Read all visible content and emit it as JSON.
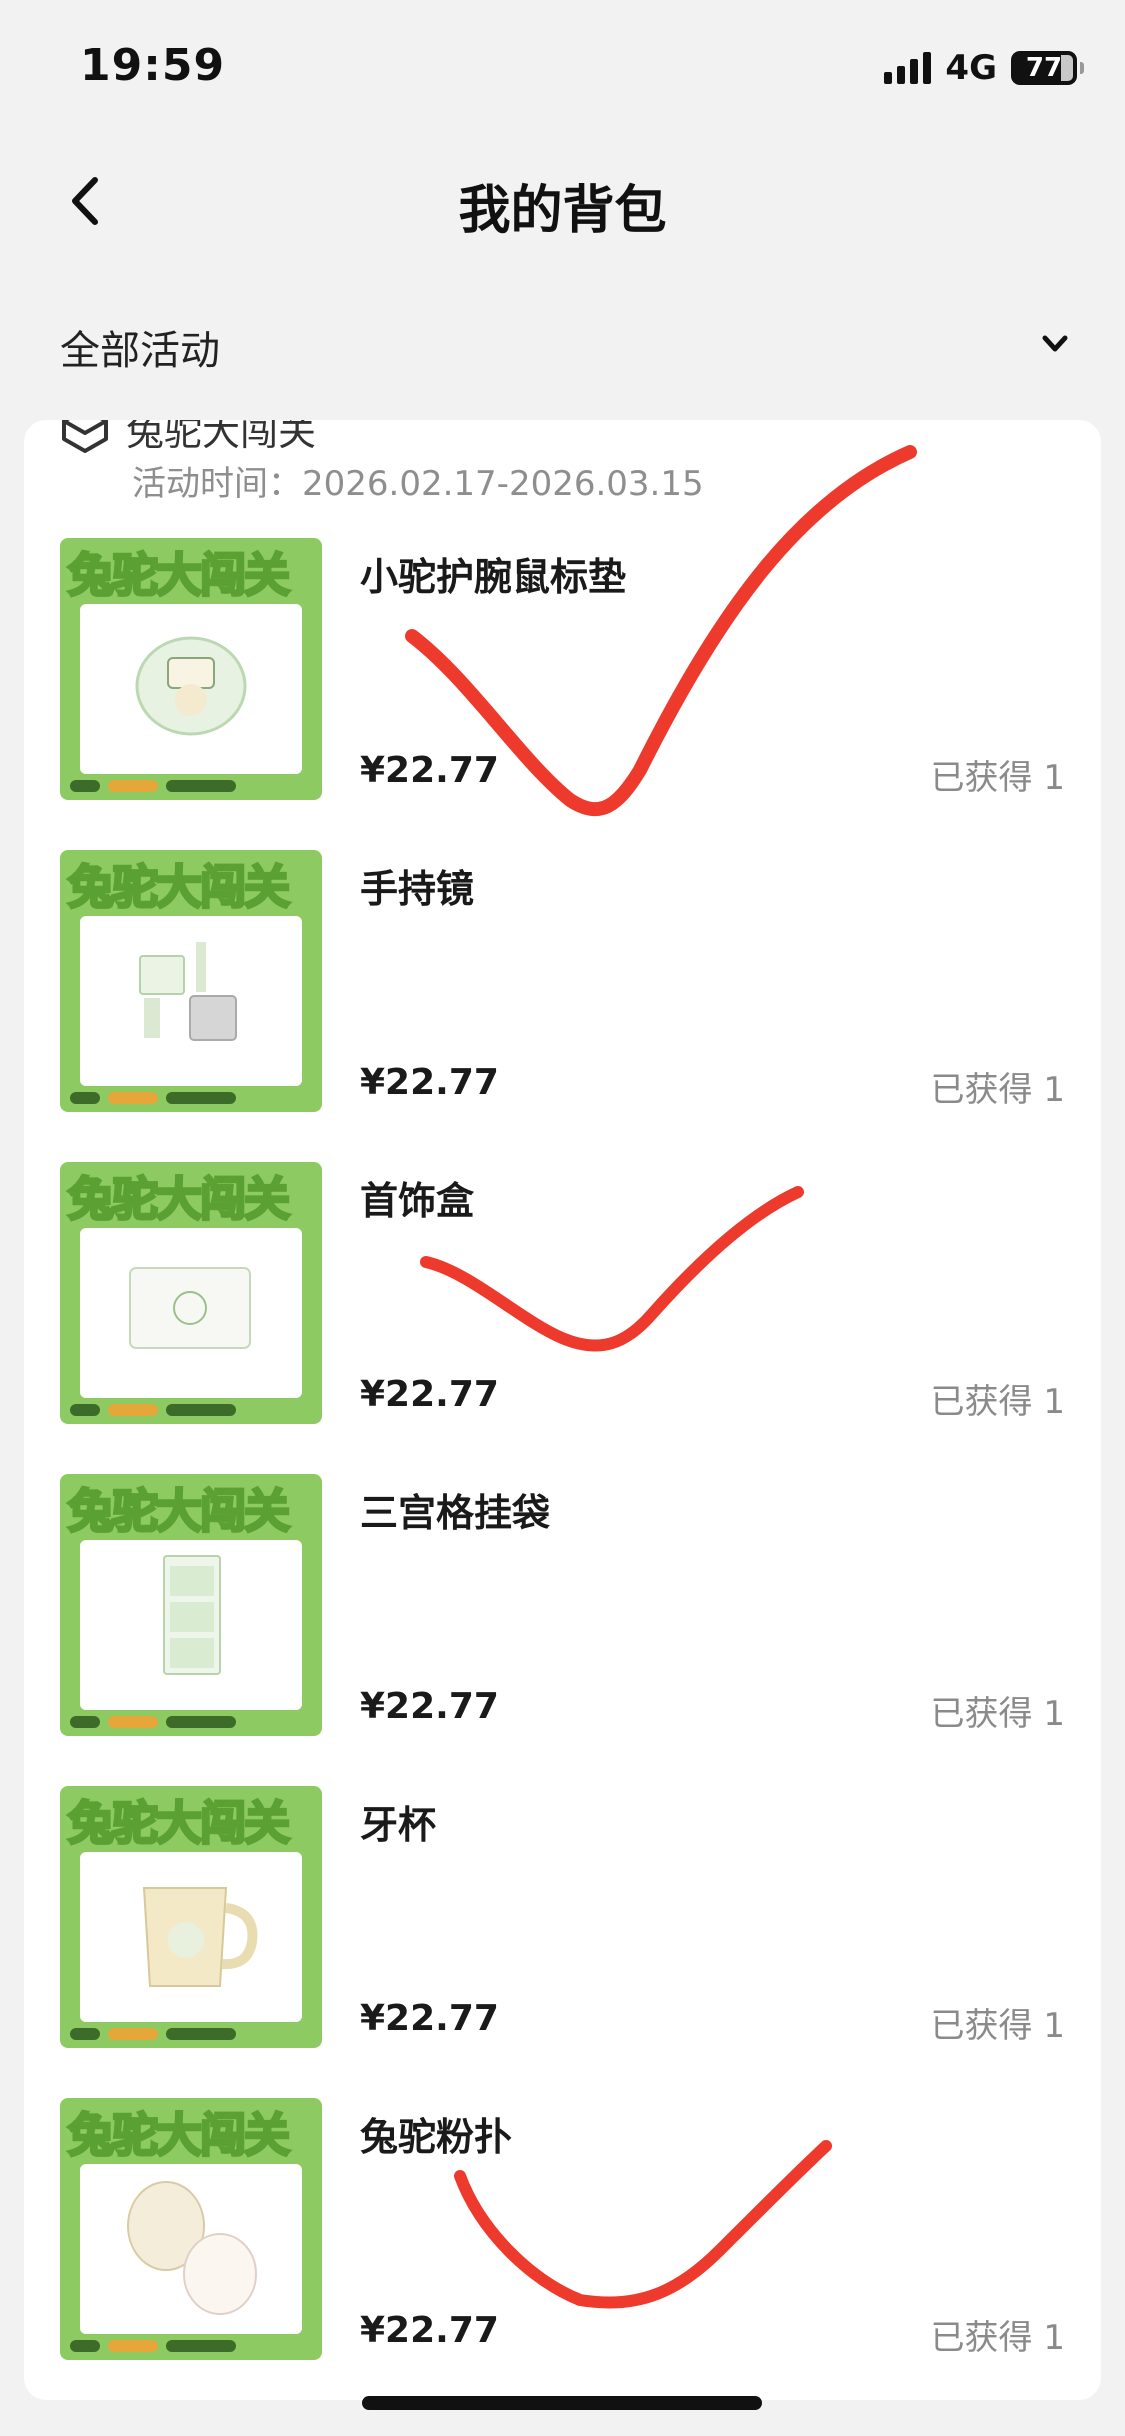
{
  "status_bar": {
    "time": "19:59",
    "network": "4G",
    "battery": "77"
  },
  "nav": {
    "title": "我的背包",
    "back_icon": "chevron-left-icon"
  },
  "filter": {
    "label": "全部活动",
    "icon": "chevron-down-icon"
  },
  "activity": {
    "name": "兔驼大闯关",
    "time_label": "活动时间：",
    "time_value": "2026.02.17-2026.03.15"
  },
  "thumbnail_banner": "兔驼大闯关",
  "items": [
    {
      "title": "小驼护腕鼠标垫",
      "price": "¥22.77",
      "status": "已获得 1"
    },
    {
      "title": "手持镜",
      "price": "¥22.77",
      "status": "已获得 1"
    },
    {
      "title": "首饰盒",
      "price": "¥22.77",
      "status": "已获得 1"
    },
    {
      "title": "三宫格挂袋",
      "price": "¥22.77",
      "status": "已获得 1"
    },
    {
      "title": "牙杯",
      "price": "¥22.77",
      "status": "已获得 1"
    },
    {
      "title": "兔驼粉扑",
      "price": "¥22.77",
      "status": "已获得 1"
    }
  ],
  "colors": {
    "background": "#f2f2f2",
    "card": "#ffffff",
    "thumbnail_green": "#8dcb62",
    "handwritten_check": "#ee3a2c",
    "muted_text": "#8a8a8a"
  }
}
